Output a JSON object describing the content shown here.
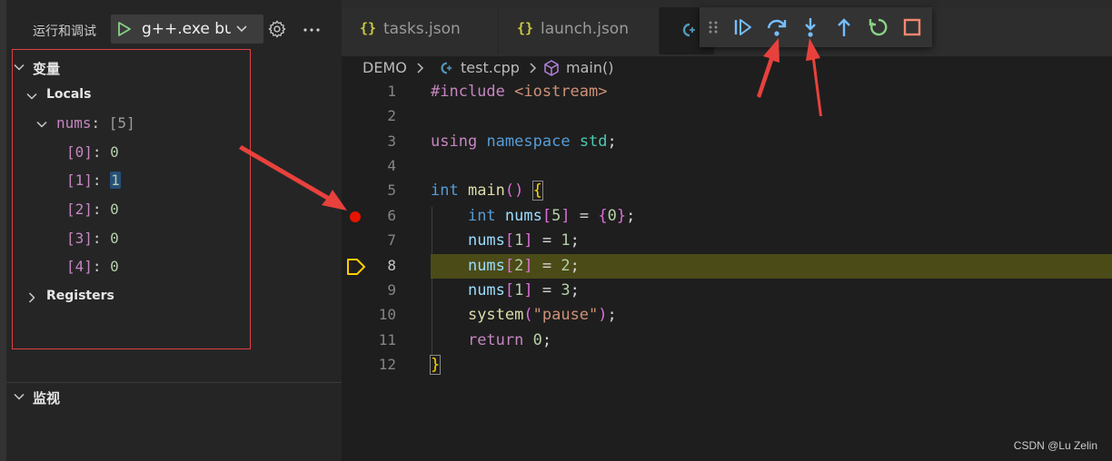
{
  "sidebar": {
    "title": "运行和调试",
    "config": "g++.exe build",
    "variables_section": "变量",
    "locals_label": "Locals",
    "nums_name": "nums",
    "nums_value": "[5]",
    "elements": [
      {
        "index": "[0]",
        "value": "0"
      },
      {
        "index": "[1]",
        "value": "1"
      },
      {
        "index": "[2]",
        "value": "0"
      },
      {
        "index": "[3]",
        "value": "0"
      },
      {
        "index": "[4]",
        "value": "0"
      }
    ],
    "registers_label": "Registers",
    "watch_section": "监视"
  },
  "tabs": [
    {
      "icon": "{}",
      "label": "tasks.json"
    },
    {
      "icon": "{}",
      "label": "launch.json"
    }
  ],
  "breadcrumb": {
    "root": "DEMO",
    "file": "test.cpp",
    "symbol": "main()"
  },
  "code": {
    "line_numbers": [
      "1",
      "2",
      "3",
      "4",
      "5",
      "6",
      "7",
      "8",
      "9",
      "10",
      "11",
      "12"
    ],
    "current_line": "8",
    "breakpoint_line": "6"
  },
  "colors": {
    "breakpoint": "#e51400",
    "current_line_bg": "#4b4b18",
    "annotation_red": "#e04040",
    "debug_blue": "#75beff",
    "debug_green": "#89d185",
    "debug_red": "#f48771"
  },
  "watermark": "CSDN @Lu Zelin"
}
